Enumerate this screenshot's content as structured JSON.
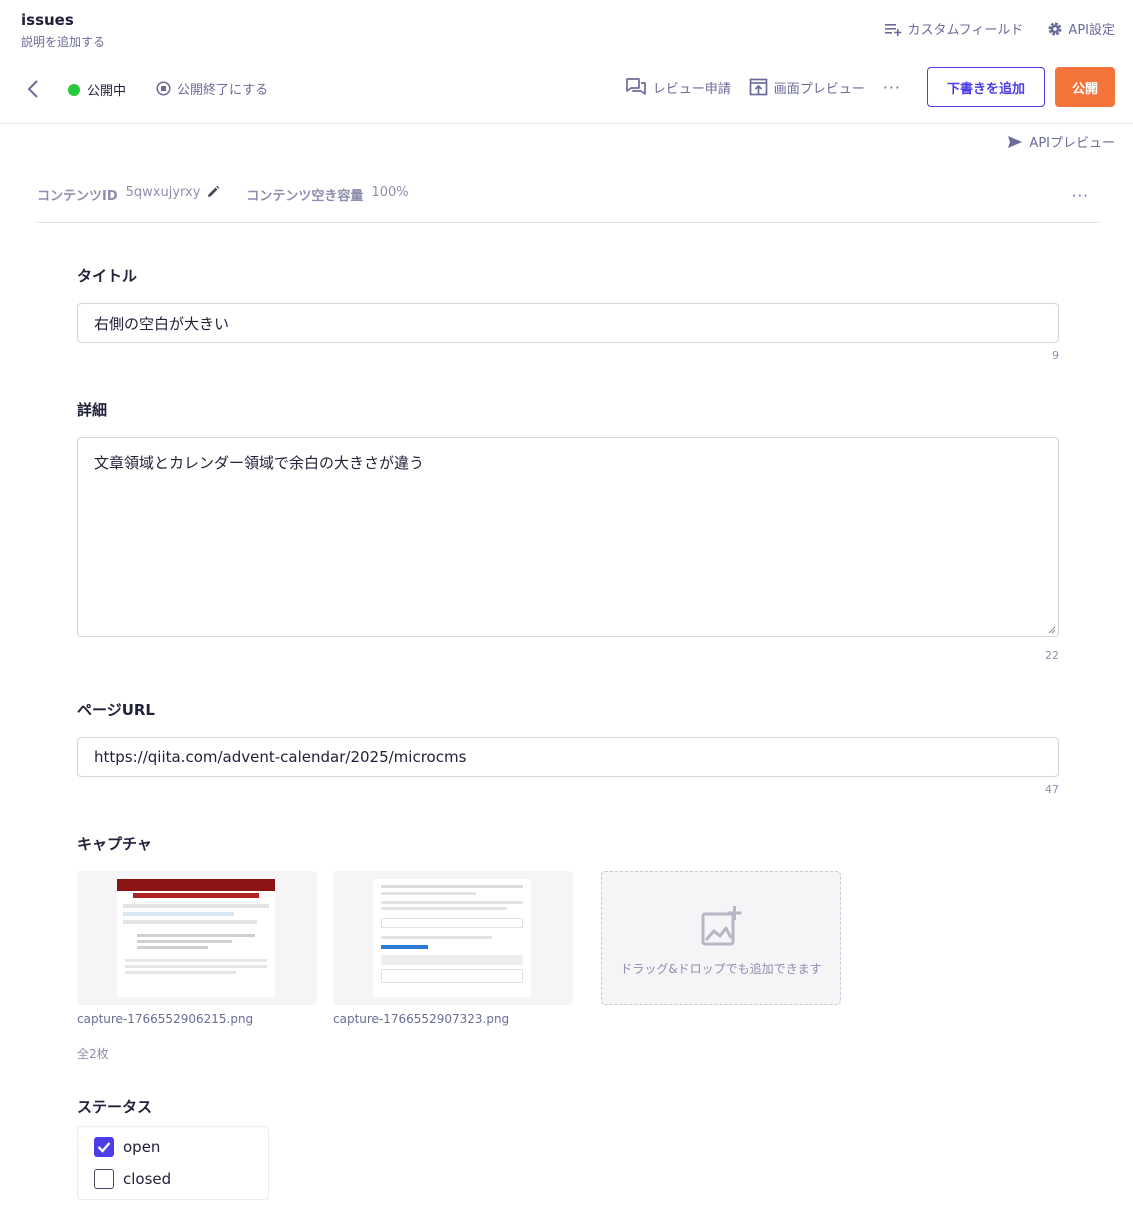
{
  "app": {
    "title": "issues",
    "description_link": "説明を追加する"
  },
  "top_links": {
    "custom_fields": "カスタムフィールド",
    "api_settings": "API設定"
  },
  "status_bar": {
    "published_status": "公開中",
    "unpublish_label": "公開終了にする"
  },
  "actions": {
    "review_request": "レビュー申請",
    "screen_preview": "画面プレビュー",
    "more": "···",
    "add_draft": "下書きを追加",
    "publish": "公開"
  },
  "api_preview": "APIプレビュー",
  "meta": {
    "content_id_label": "コンテンツID",
    "content_id_value": "5qwxujyrxy",
    "capacity_label": "コンテンツ空き容量",
    "capacity_value": "100%",
    "more": "···"
  },
  "fields": {
    "title": {
      "label": "タイトル",
      "value": "右側の空白が大きい",
      "count": "9"
    },
    "detail": {
      "label": "詳細",
      "value": "文章領域とカレンダー領域で余白の大きさが違う",
      "count": "22"
    },
    "page_url": {
      "label": "ページURL",
      "value": "https://qiita.com/advent-calendar/2025/microcms",
      "count": "47"
    },
    "capture": {
      "label": "キャプチャ",
      "images": [
        {
          "filename": "capture-1766552906215.png"
        },
        {
          "filename": "capture-1766552907323.png"
        }
      ],
      "dropzone_text": "ドラッグ&ドロップでも追加できます",
      "total": "全2枚"
    },
    "status": {
      "label": "ステータス",
      "options": [
        {
          "label": "open",
          "checked": true
        },
        {
          "label": "closed",
          "checked": false
        }
      ]
    }
  },
  "colors": {
    "accent": "#4b3ee8",
    "publish": "#f4743b",
    "live_dot": "#25c93a",
    "muted": "#6b6b9a"
  }
}
